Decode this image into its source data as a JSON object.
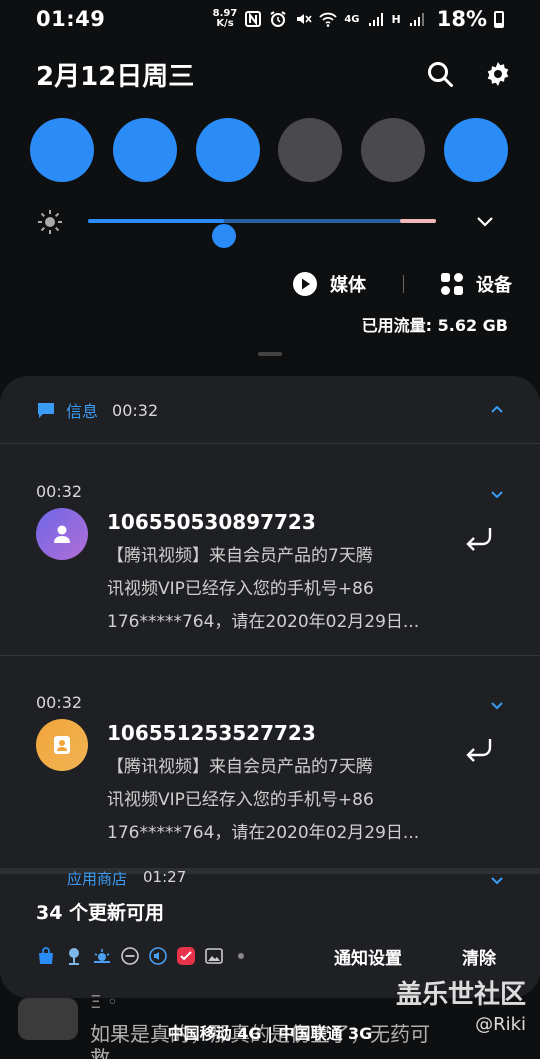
{
  "status_bar": {
    "time": "01:49",
    "speed_value": "8.97",
    "speed_unit": "K/s",
    "network_4g": "4G",
    "network_h": "H",
    "battery": "18%"
  },
  "header": {
    "date": "2月12日周三",
    "search_icon": "search-icon",
    "settings_icon": "gear-icon"
  },
  "quick_toggles": [
    {
      "state": "on"
    },
    {
      "state": "on"
    },
    {
      "state": "on"
    },
    {
      "state": "off"
    },
    {
      "state": "off"
    },
    {
      "state": "on"
    }
  ],
  "brightness": {
    "level": 0.39
  },
  "media": {
    "media_label": "媒体",
    "devices_label": "设备"
  },
  "data_usage": "已用流量: 5.62 GB",
  "notification_group": {
    "app_name": "信息",
    "time": "00:32",
    "messages": [
      {
        "time": "00:32",
        "sender": "106550530897723",
        "lines": [
          "【腾讯视频】来自会员产品的7天腾",
          "讯视频VIP已经存入您的手机号+86",
          "176*****764，请在2020年02月29日..."
        ]
      },
      {
        "time": "00:32",
        "sender": "106551253527723",
        "lines": [
          "【腾讯视频】来自会员产品的7天腾",
          "讯视频VIP已经存入您的手机号+86",
          "176*****764，请在2020年02月29日..."
        ]
      }
    ]
  },
  "app_store": {
    "app_name": "应用商店",
    "time": "01:27",
    "title": "34 个更新可用",
    "settings_label": "通知设置",
    "clear_label": "清除"
  },
  "background": {
    "name_partial": "Ξ ◦",
    "text1": "如果是真的，那真的是伤宝了，无药可",
    "text2": "救"
  },
  "carrier": "中国移动 4G | 中国联通 3G",
  "watermark": {
    "big": "盖乐世社区",
    "small": "@Riki"
  },
  "colors": {
    "accent": "#2b8cf7",
    "panel": "#1f2023",
    "app_name": "#3a9cf4"
  }
}
